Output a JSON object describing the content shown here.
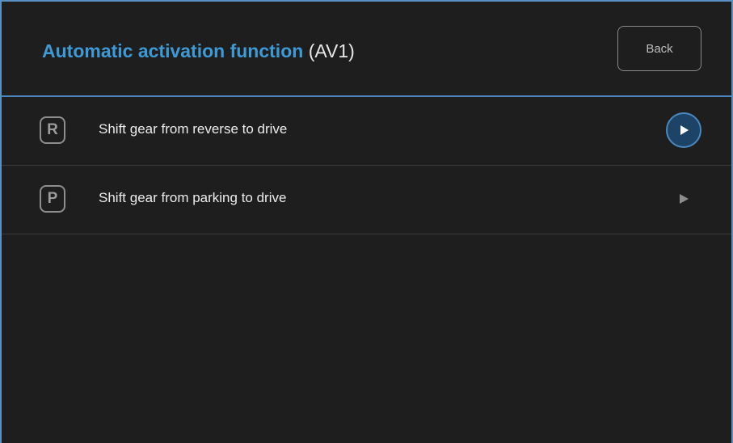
{
  "header": {
    "title_main": "Automatic activation function",
    "title_suffix": "(AV1)",
    "back_label": "Back"
  },
  "items": [
    {
      "badge": "R",
      "label": "Shift gear from reverse to drive",
      "icon": "play-circle-icon",
      "selected": true
    },
    {
      "badge": "P",
      "label": "Shift gear from parking to drive",
      "icon": "play-arrow-icon",
      "selected": false
    }
  ],
  "colors": {
    "accent": "#3d9ad6",
    "background": "#1e1e1e",
    "selected_circle": "#1d4466"
  }
}
